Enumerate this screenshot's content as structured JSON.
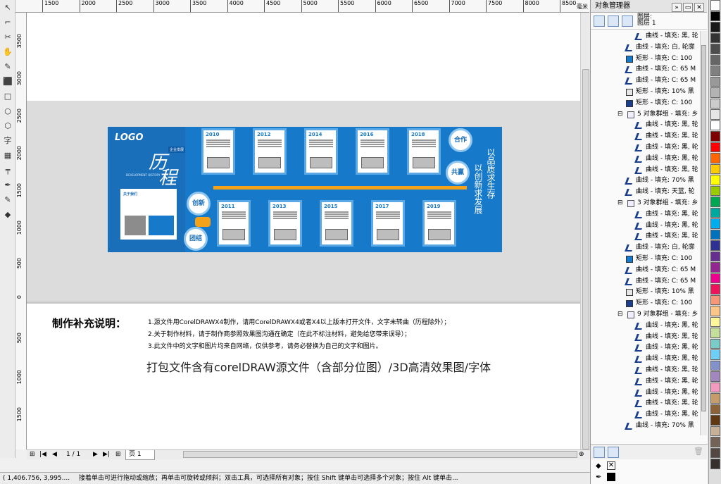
{
  "ruler": {
    "h_ticks": [
      "1500",
      "2000",
      "2500",
      "3000",
      "3500",
      "4000",
      "4500",
      "5000",
      "5500",
      "6000",
      "6500",
      "7000",
      "7500",
      "8000",
      "8500"
    ],
    "h_unit": "毫米",
    "v_ticks": [
      "3500",
      "3000",
      "2500",
      "2000",
      "1500",
      "1000",
      "500",
      "0",
      "500",
      "1000",
      "1500"
    ]
  },
  "toolbox": [
    "select-tool",
    "shape-tool",
    "crop-tool",
    "zoom-tool",
    "freehand-tool",
    "smart-fill-tool",
    "rectangle-tool",
    "ellipse-tool",
    "polygon-tool",
    "text-tool",
    "table-tool",
    "dimension-tool",
    "eyedropper-tool",
    "outline-tool",
    "fill-tool"
  ],
  "toolbox_glyphs": [
    "↖",
    "⌐",
    "✂",
    "✋",
    "✎",
    "⬛",
    "□",
    "○",
    "⬡",
    "字",
    "▦",
    "╤",
    "✒",
    "✎",
    "◆"
  ],
  "design": {
    "logo": "LOGO",
    "calligraphy_1": "历",
    "calligraphy_2": "程",
    "subtitle_badge": "企业发展",
    "english_sub": "DEVELOPMENT HISTORY",
    "about": "关于我们",
    "years_top": [
      "2010",
      "2012",
      "2014",
      "2016",
      "2018"
    ],
    "years_bottom": [
      "2011",
      "2013",
      "2015",
      "2017",
      "2019"
    ],
    "circle_labels": [
      "合作",
      "共赢",
      "创新",
      "团结"
    ],
    "vertical_right_1": "以品质求生存",
    "vertical_right_2": "以创新求发展"
  },
  "notes": {
    "heading": "制作补充说明：",
    "lines": [
      "1.源文件用CorelDRAWX4制作，请用CorelDRAWX4或者X4以上版本打开文件，文字未转曲（历程除外）；",
      "2.关于制作材料，请于制作商参照效果图沟通在确定（在此不标注材料，避免给您带来误导）；",
      "3.此文件中的文字和图片均来自网络，仅供参考，请务必替换为自己的文字和图片。"
    ],
    "package": "打包文件含有corelDRAW源文件（含部分位图）/3D高清效果图/字体"
  },
  "pagenav": {
    "counter": "1 / 1",
    "page_tab": "页 1"
  },
  "status": {
    "coords": "( 1,406.756, 3,995....",
    "hint": "接着单击可进行拖动或缩放；再单击可旋转或倾斜；双击工具，可选择所有对象；按住 Shift 键单击可选择多个对象；按住 Alt 键单击..."
  },
  "docker": {
    "title": "对象管理器",
    "layer_label": "图层:",
    "layer_value": "图层 1",
    "rows": [
      {
        "indent": 3,
        "icon": "curve",
        "text": "曲线 - 填充: 黑, 轮"
      },
      {
        "indent": 2,
        "icon": "curve",
        "text": "曲线 - 填充: 白, 轮廓"
      },
      {
        "indent": 2,
        "icon": "rect-blue",
        "text": "矩形 - 填充: C: 100"
      },
      {
        "indent": 2,
        "icon": "curve",
        "text": "曲线 - 填充: C: 65 M"
      },
      {
        "indent": 2,
        "icon": "curve",
        "text": "曲线 - 填充: C: 65 M"
      },
      {
        "indent": 2,
        "icon": "rect-gray",
        "text": "矩形 - 填充: 10% 黑"
      },
      {
        "indent": 2,
        "icon": "rect-navy",
        "text": "矩形 - 填充: C: 100"
      },
      {
        "indent": 1,
        "icon": "group",
        "text": "5 对象群组 - 填充: 乡"
      },
      {
        "indent": 3,
        "icon": "curve",
        "text": "曲线 - 填充: 黑, 轮"
      },
      {
        "indent": 3,
        "icon": "curve",
        "text": "曲线 - 填充: 黑, 轮"
      },
      {
        "indent": 3,
        "icon": "curve",
        "text": "曲线 - 填充: 黑, 轮"
      },
      {
        "indent": 3,
        "icon": "curve",
        "text": "曲线 - 填充: 黑, 轮"
      },
      {
        "indent": 3,
        "icon": "curve",
        "text": "曲线 - 填充: 黑, 轮"
      },
      {
        "indent": 2,
        "icon": "curve",
        "text": "曲线 - 填充: 70% 黑"
      },
      {
        "indent": 2,
        "icon": "curve",
        "text": "曲线 - 填充: 天蓝, 轮"
      },
      {
        "indent": 1,
        "icon": "group",
        "text": "3 对象群组 - 填充: 乡"
      },
      {
        "indent": 3,
        "icon": "curve",
        "text": "曲线 - 填充: 黑, 轮"
      },
      {
        "indent": 3,
        "icon": "curve",
        "text": "曲线 - 填充: 黑, 轮"
      },
      {
        "indent": 3,
        "icon": "curve",
        "text": "曲线 - 填充: 黑, 轮"
      },
      {
        "indent": 2,
        "icon": "curve",
        "text": "曲线 - 填充: 白, 轮廓"
      },
      {
        "indent": 2,
        "icon": "rect-blue",
        "text": "矩形 - 填充: C: 100"
      },
      {
        "indent": 2,
        "icon": "curve",
        "text": "曲线 - 填充: C: 65 M"
      },
      {
        "indent": 2,
        "icon": "curve",
        "text": "曲线 - 填充: C: 65 M"
      },
      {
        "indent": 2,
        "icon": "rect-gray",
        "text": "矩形 - 填充: 10% 黑"
      },
      {
        "indent": 2,
        "icon": "rect-navy",
        "text": "矩形 - 填充: C: 100"
      },
      {
        "indent": 1,
        "icon": "group",
        "text": "9 对象群组 - 填充: 乡"
      },
      {
        "indent": 3,
        "icon": "curve",
        "text": "曲线 - 填充: 黑, 轮"
      },
      {
        "indent": 3,
        "icon": "curve",
        "text": "曲线 - 填充: 黑, 轮"
      },
      {
        "indent": 3,
        "icon": "curve",
        "text": "曲线 - 填充: 黑, 轮"
      },
      {
        "indent": 3,
        "icon": "curve",
        "text": "曲线 - 填充: 黑, 轮"
      },
      {
        "indent": 3,
        "icon": "curve",
        "text": "曲线 - 填充: 黑, 轮"
      },
      {
        "indent": 3,
        "icon": "curve",
        "text": "曲线 - 填充: 黑, 轮"
      },
      {
        "indent": 3,
        "icon": "curve",
        "text": "曲线 - 填充: 黑, 轮"
      },
      {
        "indent": 3,
        "icon": "curve",
        "text": "曲线 - 填充: 黑, 轮"
      },
      {
        "indent": 3,
        "icon": "curve",
        "text": "曲线 - 填充: 黑, 轮"
      },
      {
        "indent": 2,
        "icon": "curve",
        "text": "曲线 - 填充: 70% 黑"
      }
    ]
  },
  "palette": [
    "#ffffff",
    "#000000",
    "#1a1a1a",
    "#333333",
    "#4d4d4d",
    "#666666",
    "#808080",
    "#999999",
    "#b3b3b3",
    "#cccccc",
    "#e6e6e6",
    "#ffffff",
    "#7f0000",
    "#ff0000",
    "#ff6600",
    "#ffcc00",
    "#ffff00",
    "#99cc00",
    "#00a651",
    "#00a99d",
    "#00aeef",
    "#0072bc",
    "#2e3192",
    "#662d91",
    "#92278f",
    "#ec008c",
    "#ed145b",
    "#f7977a",
    "#fdc689",
    "#fff799",
    "#c4df9b",
    "#7accc8",
    "#6dcff6",
    "#8393ca",
    "#a187be",
    "#f49ac1",
    "#c69c6d",
    "#8c6239",
    "#603913",
    "#c7b299",
    "#736357",
    "#534741",
    "#362f2d"
  ],
  "colors": {
    "design_blue": "#1679c9",
    "accent_orange": "#f5a21b"
  }
}
